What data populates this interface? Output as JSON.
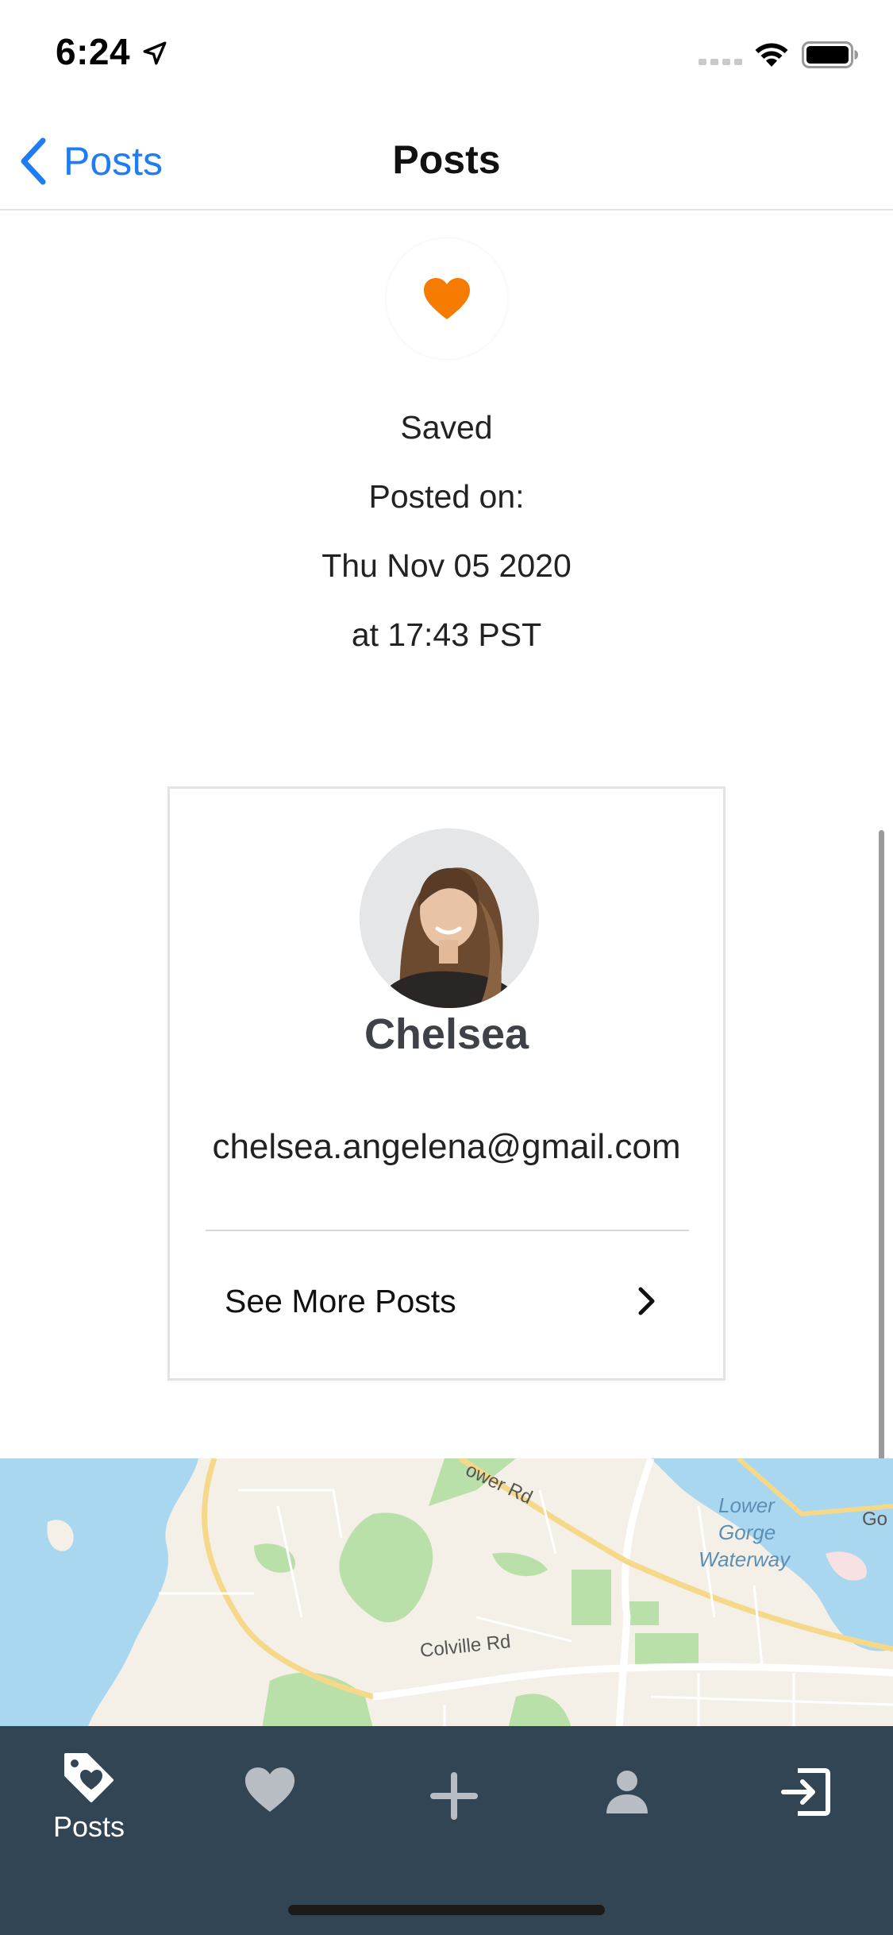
{
  "status_bar": {
    "time": "6:24",
    "icons": [
      "location-arrow-icon",
      "cellular-signal-icon",
      "wifi-icon",
      "battery-icon"
    ]
  },
  "nav": {
    "back_label": "Posts",
    "title": "Posts"
  },
  "post": {
    "status": "Saved",
    "posted_on_label": "Posted on:",
    "date": "Thu Nov 05 2020",
    "time": "at 17:43 PST"
  },
  "user": {
    "name": "Chelsea",
    "email": "chelsea.angelena@gmail.com",
    "see_more_label": "See More Posts"
  },
  "map": {
    "labels": {
      "lower_rd": "ower Rd",
      "colville_rd": "Colville Rd",
      "waterway_1": "Lower",
      "waterway_2": "Gorge",
      "waterway_3": "Waterway",
      "go": "Go"
    }
  },
  "tab_bar": {
    "tabs": [
      {
        "name": "posts",
        "label": "Posts",
        "icon": "tag-heart-icon",
        "active": true
      },
      {
        "name": "favorites",
        "label": "",
        "icon": "heart-icon",
        "active": false
      },
      {
        "name": "add",
        "label": "",
        "icon": "plus-icon",
        "active": false
      },
      {
        "name": "profile",
        "label": "",
        "icon": "person-icon",
        "active": false
      },
      {
        "name": "logout",
        "label": "",
        "icon": "exit-icon",
        "active": false
      }
    ]
  },
  "colors": {
    "accent_blue": "#1f7cf2",
    "heart_orange": "#f57c00",
    "tab_bar_bg": "#324554",
    "tab_icon_inactive": "#b7bdc2"
  }
}
